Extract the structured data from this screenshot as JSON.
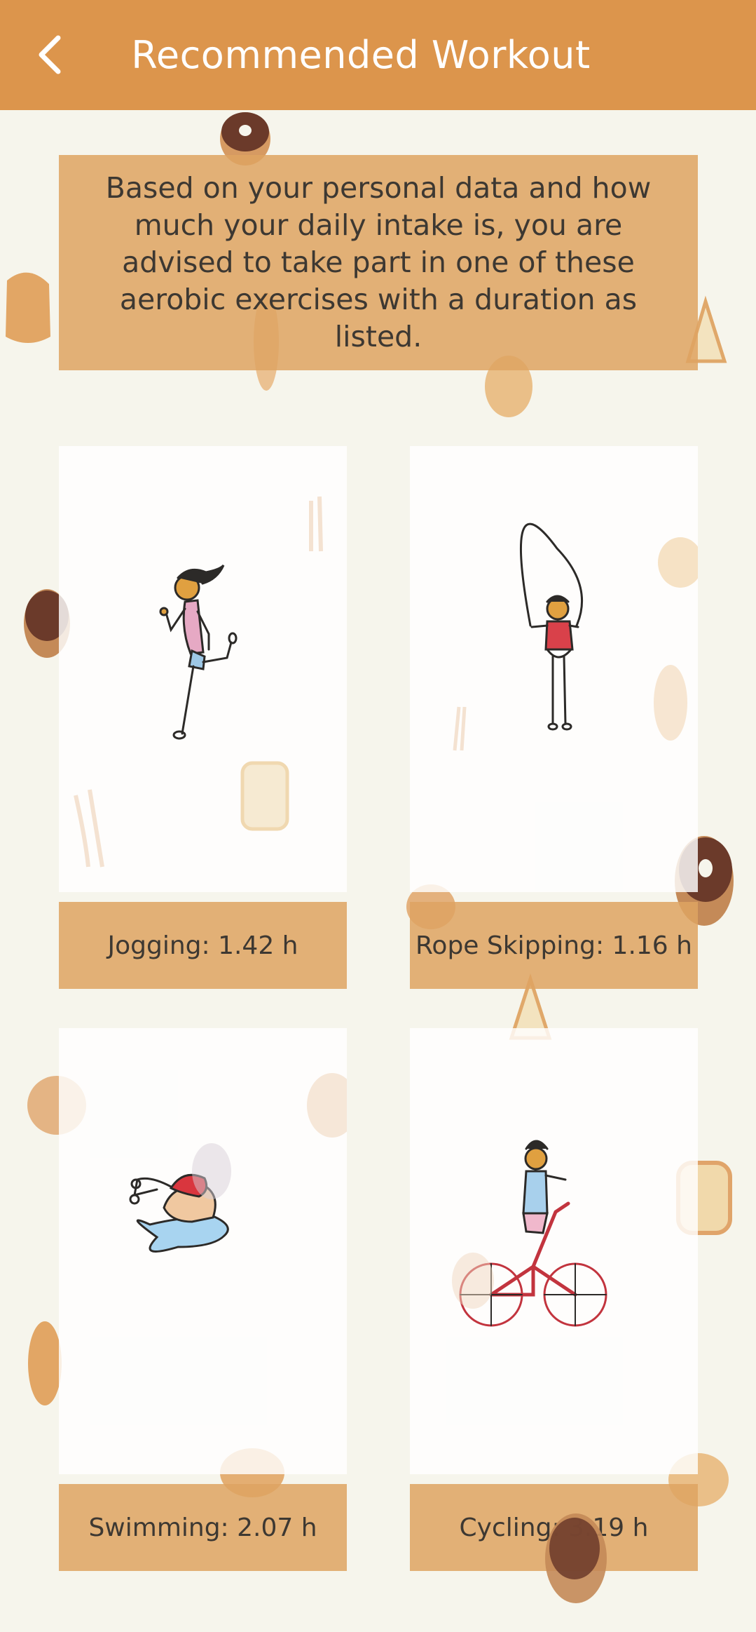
{
  "header": {
    "title": "Recommended Workout",
    "back_icon": "chevron-left-icon"
  },
  "intro": {
    "text": "Based on your personal data and how much your daily intake is, you are advised to take part in one of these aerobic exercises with a duration as listed."
  },
  "workouts": [
    {
      "label": "Jogging: 1.42 h",
      "icon": "jogging-illustration"
    },
    {
      "label": "Rope Skipping: 1.16 h",
      "icon": "rope-skipping-illustration"
    },
    {
      "label": "Swimming: 2.07 h",
      "icon": "swimming-illustration"
    },
    {
      "label": "Cycling: 3.19 h",
      "icon": "cycling-illustration"
    }
  ],
  "colors": {
    "app_bar": "#dc954c",
    "panel": "#dea361",
    "background": "#f6f5ec"
  }
}
